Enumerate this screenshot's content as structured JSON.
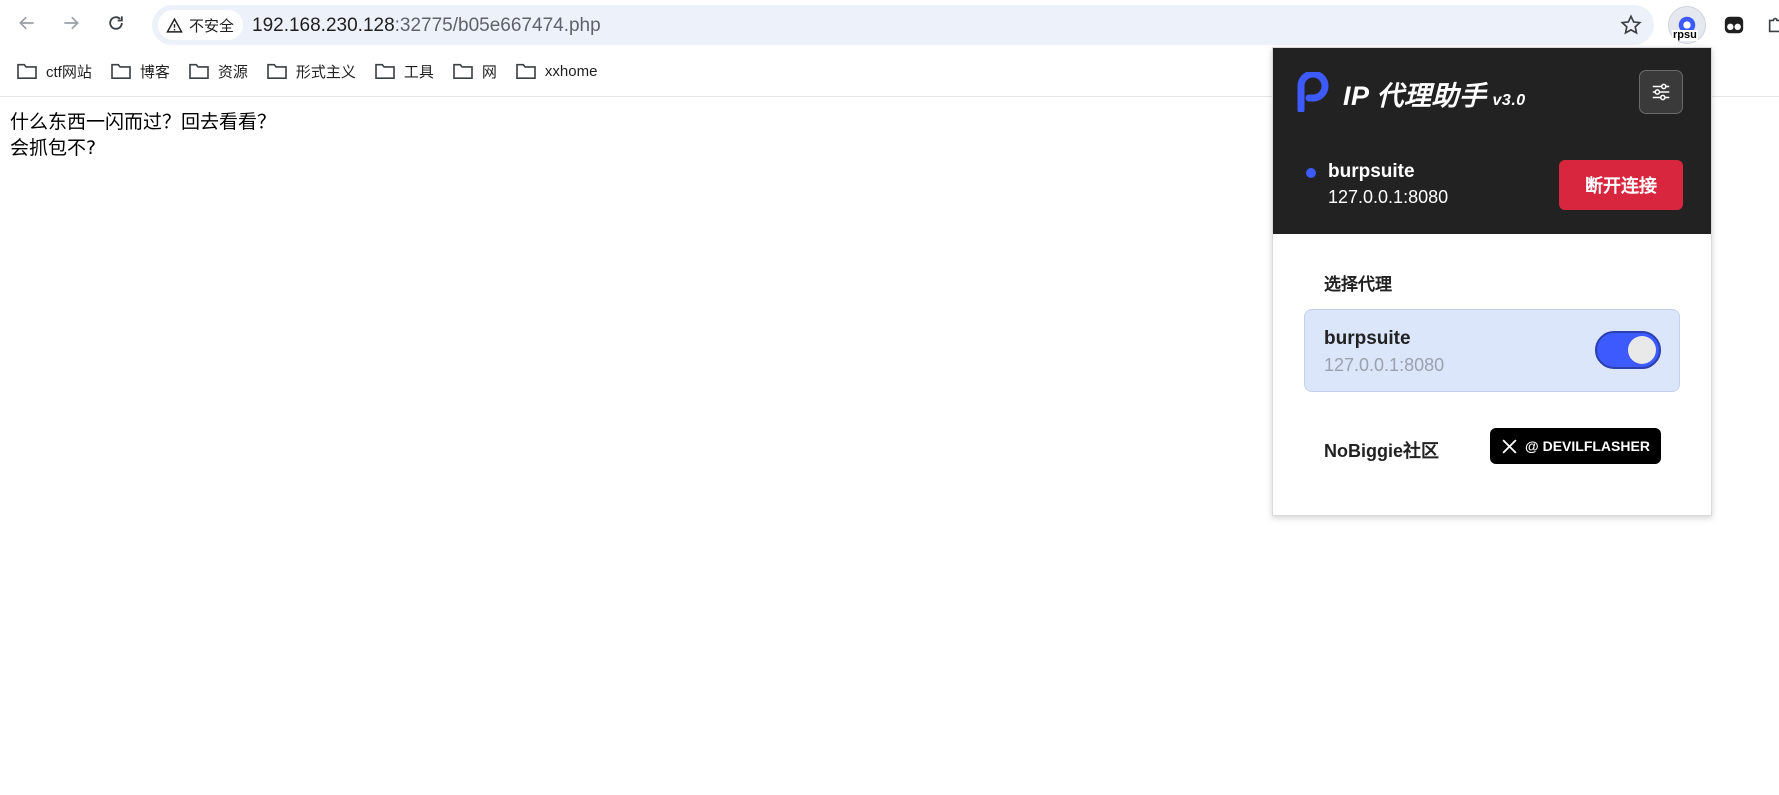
{
  "toolbar": {
    "security_label": "不安全",
    "url_host": "192.168.230.128",
    "url_rest": ":32775/b05e667474.php",
    "extension_badge": "rpsu"
  },
  "bookmarks": [
    {
      "label": "ctf网站"
    },
    {
      "label": "博客"
    },
    {
      "label": "资源"
    },
    {
      "label": "形式主义"
    },
    {
      "label": "工具"
    },
    {
      "label": "网"
    },
    {
      "label": "xxhome"
    }
  ],
  "page": {
    "line1": "什么东西一闪而过？回去看看？",
    "line2": "会抓包不?"
  },
  "popup": {
    "title": "IP 代理助手",
    "version": "v3.0",
    "current": {
      "name": "burpsuite",
      "address": "127.0.0.1:8080"
    },
    "disconnect_label": "断开连接",
    "section_title": "选择代理",
    "proxies": [
      {
        "name": "burpsuite",
        "address": "127.0.0.1:8080",
        "enabled": true
      }
    ],
    "community_label": "NoBiggie社区",
    "x_button_label": "@ DEVILFLASHER"
  },
  "colors": {
    "accent": "#3d5afe",
    "danger": "#d7263d",
    "header_bg": "#222222",
    "card_bg": "#dce6fb"
  }
}
